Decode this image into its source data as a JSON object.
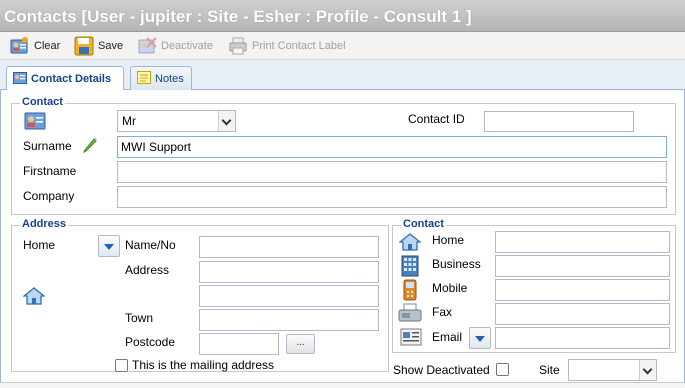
{
  "window": {
    "title": "Contacts [User - jupiter : Site - Esher : Profile - Consult 1 ]"
  },
  "toolbar": {
    "clear_label": "Clear",
    "save_label": "Save",
    "deactivate_label": "Deactivate",
    "print_label": "Print Contact Label"
  },
  "tabs": [
    {
      "label": "Contact Details"
    },
    {
      "label": "Notes"
    }
  ],
  "contact": {
    "legend": "Contact",
    "title_value": "Mr",
    "contact_id_label": "Contact ID",
    "contact_id_value": "",
    "surname_label": "Surname",
    "surname_value": "MWI Support",
    "firstname_label": "Firstname",
    "firstname_value": "",
    "company_label": "Company",
    "company_value": ""
  },
  "address": {
    "legend": "Address",
    "type_label": "Home",
    "name_no_label": "Name/No",
    "address_label": "Address",
    "town_label": "Town",
    "postcode_label": "Postcode",
    "lookup_label": "...",
    "mailing_label": "This is the mailing address",
    "mailing_checked": false
  },
  "contact_numbers": {
    "legend": "Contact",
    "home_label": "Home",
    "business_label": "Business",
    "mobile_label": "Mobile",
    "fax_label": "Fax",
    "email_label": "Email"
  },
  "footer": {
    "show_deactivated_label": "Show Deactivated",
    "show_deactivated_checked": false,
    "site_label": "Site",
    "site_value": ""
  },
  "colors": {
    "accent": "#15428b",
    "title_bar": "#b8b8b8"
  }
}
